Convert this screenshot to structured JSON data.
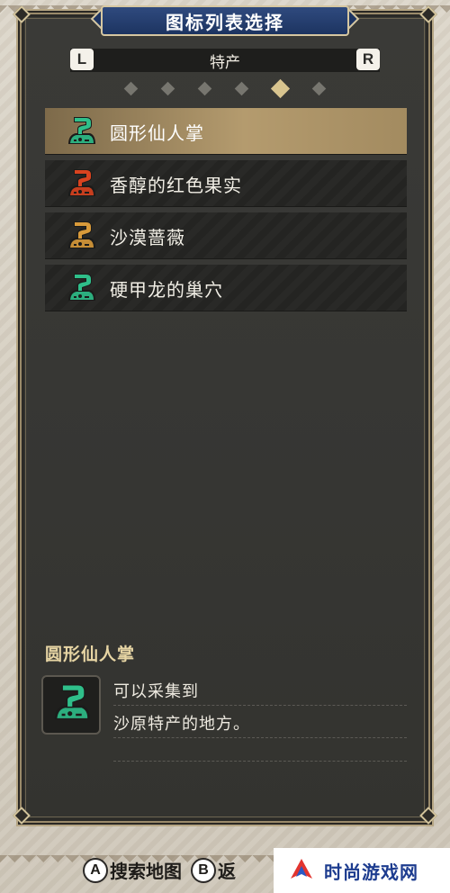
{
  "window": {
    "title": "图标列表选择"
  },
  "category": {
    "label": "特产",
    "left_button": "L",
    "right_button": "R"
  },
  "pages": {
    "total": 6,
    "active_index": 4
  },
  "icon_colors": {
    "green": "#2fbf8a",
    "red": "#d9431f",
    "orange": "#d89a3a"
  },
  "list": {
    "items": [
      {
        "label": "圆形仙人掌",
        "icon": "question-bag-icon",
        "color": "green",
        "selected": true
      },
      {
        "label": "香醇的红色果实",
        "icon": "question-bag-icon",
        "color": "red",
        "selected": false
      },
      {
        "label": "沙漠蔷薇",
        "icon": "question-bag-icon",
        "color": "orange",
        "selected": false
      },
      {
        "label": "硬甲龙的巢穴",
        "icon": "question-bag-icon",
        "color": "green",
        "selected": false
      }
    ]
  },
  "detail": {
    "title": "圆形仙人掌",
    "icon": "question-bag-icon",
    "description": [
      "可以采集到",
      "沙原特产的地方。",
      ""
    ]
  },
  "hints": [
    {
      "button": "A",
      "label": "搜索地图"
    },
    {
      "button": "B",
      "label": "返"
    }
  ],
  "watermark": {
    "text": "时尚游戏网"
  }
}
